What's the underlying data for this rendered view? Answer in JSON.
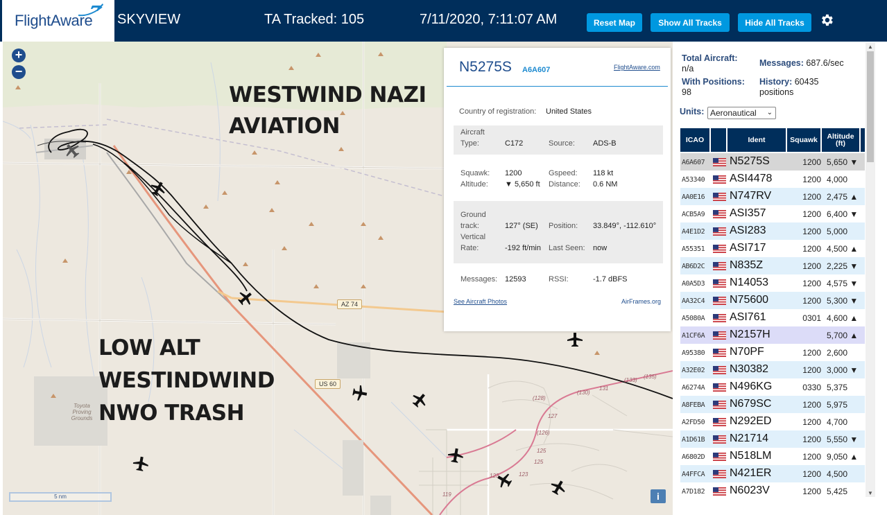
{
  "header": {
    "logo_text": "FlightAware",
    "site_name": "SKYVIEW",
    "tracked": "TA Tracked: 105",
    "datetime": "7/11/2020, 7:11:07 AM",
    "reset_map": "Reset Map",
    "show_all_tracks": "Show All Tracks",
    "hide_all_tracks": "Hide All Tracks",
    "settings_icon": "gear-icon"
  },
  "map": {
    "zoom_in": "+",
    "zoom_out": "−",
    "scale_label": "5 nm",
    "info_button": "i",
    "annotation_top_line1": "WESTWIND NAZI",
    "annotation_top_line2": "AVIATION",
    "annotation_bottom_line1": "LOW ALT",
    "annotation_bottom_line2": "WESTINDWIND",
    "annotation_bottom_line3": "NWO TRASH",
    "road_labels": [
      "AZ 74",
      "US 60"
    ],
    "place_label": "Toyota Proving Grounds",
    "route_numbers": [
      "(133)",
      "(135)",
      "(130)",
      "131",
      "(128)",
      "127",
      "(126)",
      "125",
      "125",
      "123",
      "123",
      "119"
    ]
  },
  "popup": {
    "registration": "N5275S",
    "hex": "A6A607",
    "flightaware_link": "FlightAware.com",
    "country_label": "Country of registration:",
    "country_value": "United States",
    "aircraft_type_label_1": "Aircraft",
    "aircraft_type_label_2": "Type:",
    "aircraft_type_value": "C172",
    "source_label": "Source:",
    "source_value": "ADS-B",
    "squawk_label": "Squawk:",
    "squawk_value": "1200",
    "gspeed_label": "Gspeed:",
    "gspeed_value": "118 kt",
    "altitude_label": "Altitude:",
    "altitude_value": "▼ 5,650 ft",
    "distance_label": "Distance:",
    "distance_value": "0.6 NM",
    "ground_track_label_1": "Ground",
    "ground_track_label_2": "track:",
    "ground_track_value": "127° (SE)",
    "position_label": "Position:",
    "position_value": "33.849°, -112.610°",
    "vrate_label_1": "Vertical",
    "vrate_label_2": "Rate:",
    "vrate_value": "-192 ft/min",
    "last_seen_label": "Last Seen:",
    "last_seen_value": "now",
    "messages_label": "Messages:",
    "messages_value": "12593",
    "rssi_label": "RSSI:",
    "rssi_value": "-1.7 dBFS",
    "see_photos": "See Aircraft Photos",
    "airframes": "AirFrames.org"
  },
  "stats": {
    "total_aircraft_label": "Total Aircraft:",
    "total_aircraft_value": "n/a",
    "messages_label": "Messages:",
    "messages_value": "687.6/sec",
    "with_positions_label": "With Positions:",
    "with_positions_value": "98",
    "history_label": "History:",
    "history_value": "60435",
    "history_unit": "positions",
    "units_label": "Units:",
    "units_value": "Aeronautical"
  },
  "table": {
    "columns": [
      "ICAO",
      "",
      "Ident",
      "Squawk",
      "Altitude (ft)"
    ],
    "rows": [
      {
        "icao": "A6A607",
        "ident": "N5275S",
        "squawk": "1200",
        "altitude": "5,650 ▼"
      },
      {
        "icao": "A53340",
        "ident": "ASI4478",
        "squawk": "1200",
        "altitude": "4,000"
      },
      {
        "icao": "AA0E16",
        "ident": "N747RV",
        "squawk": "1200",
        "altitude": "2,475 ▲"
      },
      {
        "icao": "ACB5A9",
        "ident": "ASI357",
        "squawk": "1200",
        "altitude": "6,400 ▼"
      },
      {
        "icao": "A4E1D2",
        "ident": "ASI283",
        "squawk": "1200",
        "altitude": "5,000"
      },
      {
        "icao": "A55351",
        "ident": "ASI717",
        "squawk": "1200",
        "altitude": "4,500 ▲"
      },
      {
        "icao": "AB6D2C",
        "ident": "N835Z",
        "squawk": "1200",
        "altitude": "2,225 ▼"
      },
      {
        "icao": "A0A5D3",
        "ident": "N14053",
        "squawk": "1200",
        "altitude": "4,575 ▼"
      },
      {
        "icao": "AA32C4",
        "ident": "N75600",
        "squawk": "1200",
        "altitude": "5,300 ▼"
      },
      {
        "icao": "A5080A",
        "ident": "ASI761",
        "squawk": "0301",
        "altitude": "4,600 ▲"
      },
      {
        "icao": "A1CF6A",
        "ident": "N2157H",
        "squawk": "",
        "altitude": "5,700 ▲"
      },
      {
        "icao": "A95380",
        "ident": "N70PF",
        "squawk": "1200",
        "altitude": "2,600"
      },
      {
        "icao": "A32E02",
        "ident": "N30382",
        "squawk": "1200",
        "altitude": "3,000 ▼"
      },
      {
        "icao": "A6274A",
        "ident": "N496KG",
        "squawk": "0330",
        "altitude": "5,375"
      },
      {
        "icao": "A8FEBA",
        "ident": "N679SC",
        "squawk": "1200",
        "altitude": "5,975"
      },
      {
        "icao": "A2FD50",
        "ident": "N292ED",
        "squawk": "1200",
        "altitude": "4,700"
      },
      {
        "icao": "A1D61B",
        "ident": "N21714",
        "squawk": "1200",
        "altitude": "5,550 ▼"
      },
      {
        "icao": "A6802D",
        "ident": "N518LM",
        "squawk": "1200",
        "altitude": "9,050 ▲"
      },
      {
        "icao": "A4FFCA",
        "ident": "N421ER",
        "squawk": "1200",
        "altitude": "4,500"
      },
      {
        "icao": "A7D182",
        "ident": "N6023V",
        "squawk": "1200",
        "altitude": "5,425"
      }
    ],
    "row_colors": {
      "selected": "#d6d6d6",
      "highlight": "#dcdcf8",
      "even": "#e0f0fb",
      "odd": "#ffffff"
    },
    "flag_icon": "us-flag-icon"
  },
  "colors": {
    "header": "#002e5b",
    "accent": "#0098e0",
    "link": "#1f4d8d"
  }
}
